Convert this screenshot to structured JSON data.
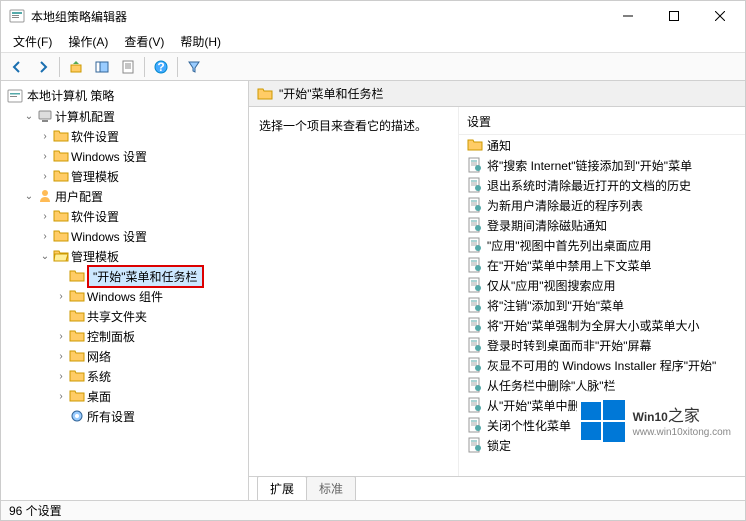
{
  "window": {
    "title": "本地组策略编辑器"
  },
  "menu": {
    "file": "文件(F)",
    "action": "操作(A)",
    "view": "查看(V)",
    "help": "帮助(H)"
  },
  "tree": {
    "root": "本地计算机 策略",
    "computer": "计算机配置",
    "user": "用户配置",
    "software": "软件设置",
    "windows": "Windows 设置",
    "templates": "管理模板",
    "startmenu": "\"开始\"菜单和任务栏",
    "components": "Windows 组件",
    "shared": "共享文件夹",
    "control": "控制面板",
    "network": "网络",
    "system": "系统",
    "desktop": "桌面",
    "all": "所有设置"
  },
  "content": {
    "header": "\"开始\"菜单和任务栏",
    "desc": "选择一个项目来查看它的描述。",
    "col": "设置",
    "items": [
      {
        "t": "folder",
        "label": "通知"
      },
      {
        "t": "policy",
        "label": "将\"搜索 Internet\"链接添加到\"开始\"菜单"
      },
      {
        "t": "policy",
        "label": "退出系统时清除最近打开的文档的历史"
      },
      {
        "t": "policy",
        "label": "为新用户清除最近的程序列表"
      },
      {
        "t": "policy",
        "label": "登录期间清除磁贴通知"
      },
      {
        "t": "policy",
        "label": "\"应用\"视图中首先列出桌面应用"
      },
      {
        "t": "policy",
        "label": "在\"开始\"菜单中禁用上下文菜单"
      },
      {
        "t": "policy",
        "label": "仅从\"应用\"视图搜索应用"
      },
      {
        "t": "policy",
        "label": "将\"注销\"添加到\"开始\"菜单"
      },
      {
        "t": "policy",
        "label": "将\"开始\"菜单强制为全屏大小或菜单大小"
      },
      {
        "t": "policy",
        "label": "登录时转到桌面而非\"开始\"屏幕"
      },
      {
        "t": "policy",
        "label": "灰显不可用的 Windows Installer 程序\"开始\""
      },
      {
        "t": "policy",
        "label": "从任务栏中删除\"人脉\"栏"
      },
      {
        "t": "policy",
        "label": "从\"开始\"菜单中删除\"最近添加\"列表"
      },
      {
        "t": "policy",
        "label": "关闭个性化菜单"
      },
      {
        "t": "policy",
        "label": "锁定"
      }
    ]
  },
  "tabs": {
    "ext": "扩展",
    "std": "标准"
  },
  "status": "96 个设置",
  "watermark": {
    "brand": "Win10",
    "suffix": "之家",
    "url": "www.win10xitong.com"
  }
}
